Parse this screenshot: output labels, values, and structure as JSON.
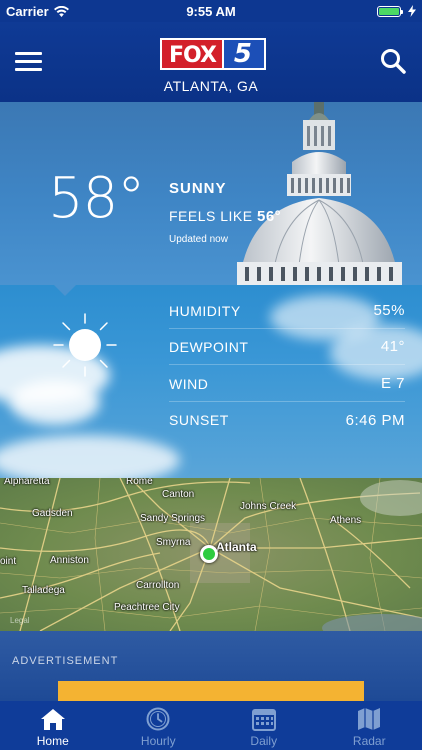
{
  "status_bar": {
    "carrier": "Carrier",
    "time": "9:55 AM"
  },
  "header": {
    "logo_text_1": "FOX",
    "logo_text_2": "5",
    "location": "ATLANTA, GA"
  },
  "current": {
    "temperature": "58°",
    "condition": "SUNNY",
    "feels_like_label": "FEELS LIKE",
    "feels_like_value": "56°",
    "updated": "Updated now"
  },
  "details": [
    {
      "label": "HUMIDITY",
      "value": "55%"
    },
    {
      "label": "DEWPOINT",
      "value": "41°"
    },
    {
      "label": "WIND",
      "value": "E 7"
    },
    {
      "label": "SUNSET",
      "value": "6:46 PM"
    }
  ],
  "map": {
    "labels": [
      "Rome",
      "Canton",
      "Gadsden",
      "Sandy Springs",
      "Johns Creek",
      "Athens",
      "Smyrna",
      "Atlanta",
      "Anniston",
      "Carrollton",
      "Talladega",
      "Peachtree City",
      "Alpharetta",
      "oint"
    ],
    "legal": "Legal"
  },
  "ad": {
    "label": "ADVERTISEMENT"
  },
  "tabs": [
    {
      "label": "Home",
      "icon": "home-icon",
      "active": true
    },
    {
      "label": "Hourly",
      "icon": "clock-icon",
      "active": false
    },
    {
      "label": "Daily",
      "icon": "calendar-icon",
      "active": false
    },
    {
      "label": "Radar",
      "icon": "map-icon",
      "active": false
    }
  ],
  "colors": {
    "header": "#0f3a95",
    "tab_bar": "#0f3c99",
    "ad_banner": "#f4b332",
    "location_dot": "#2ecc40",
    "battery": "#4cd964"
  }
}
